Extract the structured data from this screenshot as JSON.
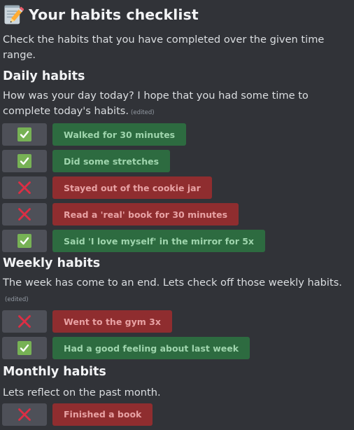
{
  "header": {
    "title": "Your habits checklist",
    "title_icon": "memo-pencil-icon",
    "subtitle": "Check the habits that you have completed over the given time range."
  },
  "colors": {
    "background": "#313338",
    "done_label": "#2d6b40",
    "missed_label": "#8f2d2f",
    "mark_button": "#4e5058",
    "check_green": "#77b255",
    "cross_red": "#dd2e44"
  },
  "sections": {
    "daily": {
      "heading": "Daily habits",
      "description": "How was your day today? I hope that you had some time to complete today's habits.",
      "edited": "(edited)",
      "items": [
        {
          "label": "Walked for 30 minutes",
          "status": "done"
        },
        {
          "label": "Did some stretches",
          "status": "done"
        },
        {
          "label": "Stayed out of the cookie jar",
          "status": "missed"
        },
        {
          "label": "Read a 'real' book for 30 minutes",
          "status": "missed"
        },
        {
          "label": "Said 'I love myself' in the mirror for 5x",
          "status": "done"
        }
      ]
    },
    "weekly": {
      "heading": "Weekly habits",
      "description": "The week has come to an end. Lets check off those weekly habits.",
      "edited": "(edited)",
      "items": [
        {
          "label": "Went to the gym 3x",
          "status": "missed"
        },
        {
          "label": "Had a good feeling about last week",
          "status": "done"
        }
      ]
    },
    "monthly": {
      "heading": "Monthly habits",
      "description": "Lets reflect on the past month.",
      "items": [
        {
          "label": "Finished a book",
          "status": "missed"
        }
      ]
    }
  }
}
